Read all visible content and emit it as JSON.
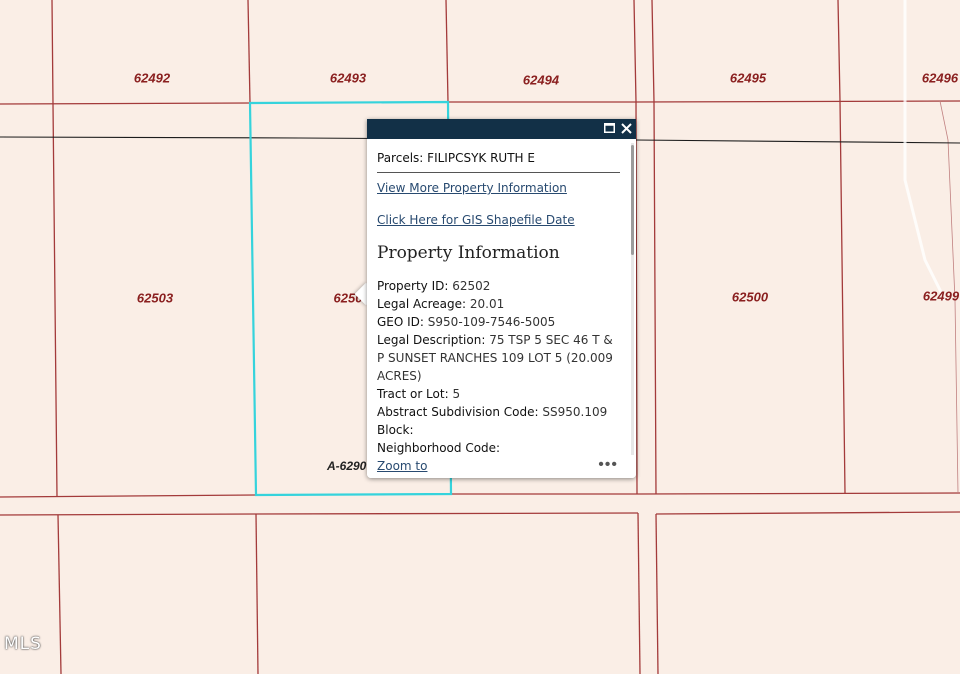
{
  "map": {
    "background_color": "#faeee6",
    "parcel_line_color": "#a33a3a",
    "selection_color": "#35d3dc",
    "parcel_labels": [
      "62492",
      "62493",
      "62494",
      "62495",
      "62496",
      "62503",
      "6250",
      "62500",
      "62499"
    ],
    "abstract_label": "A-6290",
    "watermark": "MLS"
  },
  "popup": {
    "header_color": "#123047",
    "title_prefix": "Parcels:",
    "title_value": "FILIPCSYK RUTH E",
    "link_more": "View More Property Information",
    "link_gis": "Click Here for GIS Shapefile Date",
    "section_heading": "Property Information",
    "attributes": {
      "property_id": {
        "label": "Property ID:",
        "value": "62502"
      },
      "legal_acreage": {
        "label": "Legal Acreage:",
        "value": "20.01"
      },
      "geo_id": {
        "label": "GEO ID:",
        "value": "S950-109-7546-5005"
      },
      "legal_description": {
        "label": "Legal Description:",
        "value": "75 TSP 5 SEC 46 T & P SUNSET RANCHES 109 LOT 5 (20.009 ACRES)"
      },
      "tract_or_lot": {
        "label": "Tract or Lot:",
        "value": "5"
      },
      "abstract_subdivision": {
        "label": "Abstract Subdivision Code:",
        "value": "SS950.109"
      },
      "block": {
        "label": "Block:",
        "value": ""
      },
      "neighborhood": {
        "label": "Neighborhood Code:",
        "value": ""
      }
    },
    "zoom_to": "Zoom to",
    "more_menu": "•••"
  }
}
